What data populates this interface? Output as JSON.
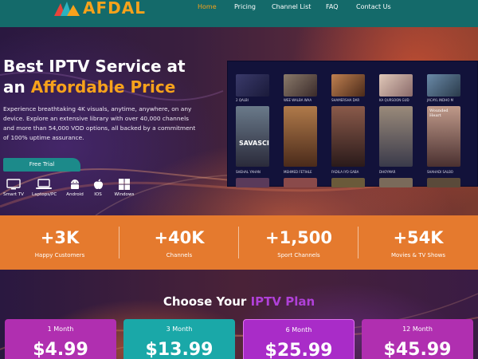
{
  "brand": {
    "name": "AFDAL",
    "accent": "#f7a21b",
    "nav_bg": "#146a6a"
  },
  "nav": {
    "items": [
      {
        "label": "Home",
        "active": true
      },
      {
        "label": "Pricing",
        "active": false
      },
      {
        "label": "Channel List",
        "active": false
      },
      {
        "label": "FAQ",
        "active": false
      },
      {
        "label": "Contact Us",
        "active": false
      }
    ]
  },
  "hero": {
    "title_line1": "Best IPTV Service at",
    "title_prefix": "an ",
    "title_highlight": "Affordable Price",
    "description": "Experience breathtaking 4K visuals, anytime, anywhere, on any device. Explore an extensive library with over 40,000 channels and more than 54,000 VOD options, all backed by a commitment of 100% uptime assurance.",
    "cta_label": "Free Trial",
    "devices": [
      {
        "label": "Smart TV",
        "icon": "tv-icon"
      },
      {
        "label": "Laptops/PC",
        "icon": "laptop-icon"
      },
      {
        "label": "Android",
        "icon": "android-icon"
      },
      {
        "label": "IOS",
        "icon": "apple-icon"
      },
      {
        "label": "Windows",
        "icon": "windows-icon"
      }
    ]
  },
  "preview": {
    "row1_captions": [
      "2 QALBI",
      "WEE WALBA WAA",
      "SHAMERSHA DAR",
      "KA QURSOON GUD",
      "JACAYL INDHO M"
    ],
    "row2_captions": [
      "SHEHAL YAHAN",
      "MEHMED FETIHLE",
      "FADILA IYO GABA",
      "DHOYMAR",
      "SHAHADI SALBO"
    ],
    "row2_poster_text": [
      "SAVASCI",
      "",
      "",
      "",
      "Wounded Heart"
    ]
  },
  "stats": [
    {
      "value": "+3K",
      "label": "Happy Customers"
    },
    {
      "value": "+40K",
      "label": "Channels"
    },
    {
      "value": "+1,500",
      "label": "Sport Channels"
    },
    {
      "value": "+54K",
      "label": "Movies & TV Shows"
    }
  ],
  "plans": {
    "title_prefix": "Choose Your ",
    "title_highlight": "IPTV Plan",
    "items": [
      {
        "name": "1 Month",
        "price": "$4.99",
        "color": "#b02fb0"
      },
      {
        "name": "3 Month",
        "price": "$13.99",
        "color": "#1aa8a8"
      },
      {
        "name": "6 Month",
        "price": "$25.99",
        "color": "#a92cc8"
      },
      {
        "name": "12 Month",
        "price": "$45.99",
        "color": "#b02fb0"
      }
    ]
  }
}
